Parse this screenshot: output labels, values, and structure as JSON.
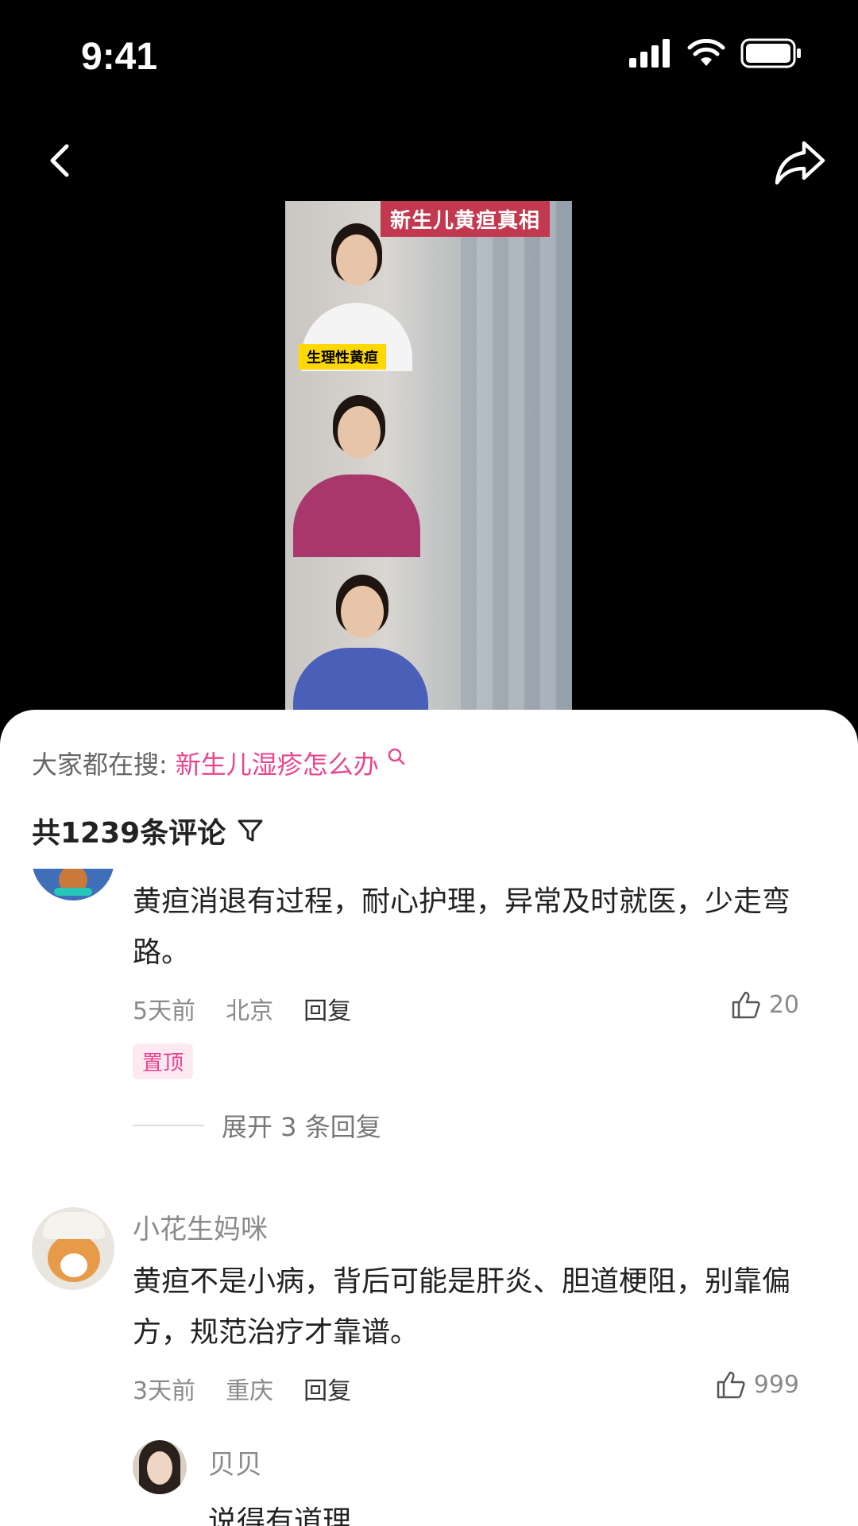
{
  "status": {
    "time": "9:41"
  },
  "video": {
    "title_overlay": "新生儿黄疸真相",
    "tag_overlay": "生理性黄疸"
  },
  "sheet": {
    "search_prefix": "大家都在搜:",
    "search_term": "新生儿湿疹怎么办",
    "comment_count": "共1239条评论"
  },
  "comments": [
    {
      "text_line1": "黄疸消退有过程，耐心护理，异常及时就医，少走弯",
      "text_line2": "路。",
      "time": "5天前",
      "location": "北京",
      "reply_label": "回复",
      "likes": "20",
      "pin_label": "置顶",
      "expand_label": "展开 3 条回复"
    },
    {
      "username": "小花生妈咪",
      "text_line1": "黄疸不是小病，背后可能是肝炎、胆道梗阻，别靠偏",
      "text_line2": "方，规范治疗才靠谱。",
      "time": "3天前",
      "location": "重庆",
      "reply_label": "回复",
      "likes": "999"
    },
    {
      "username": "贝贝",
      "text_line1": "说得有道理"
    }
  ],
  "colors": {
    "accent": "#e8458f",
    "background": "#000000"
  }
}
